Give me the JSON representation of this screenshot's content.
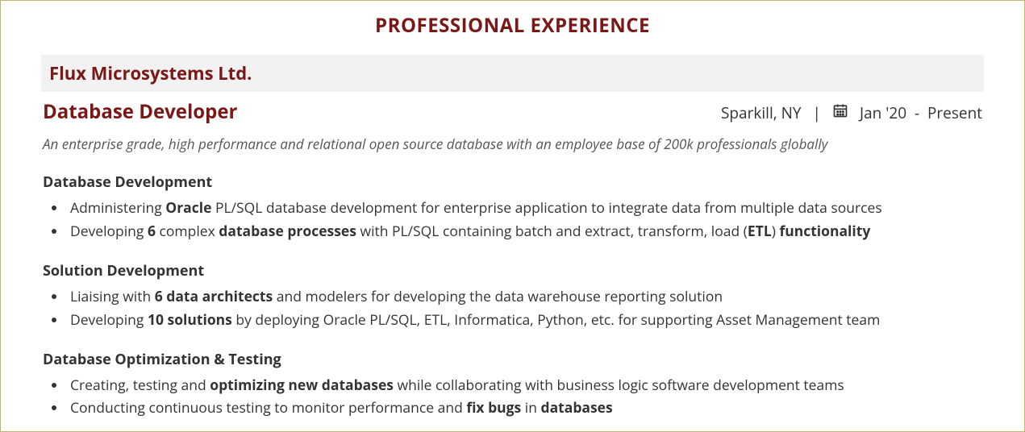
{
  "section_title": "PROFESSIONAL EXPERIENCE",
  "company": "Flux Microsystems Ltd.",
  "job_title": "Database Developer",
  "location": "Sparkill, NY",
  "date_start": "Jan '20",
  "date_end": "Present",
  "summary": "An enterprise grade, high performance and relational open source database with an employee base of 200k professionals globally",
  "groups": [
    {
      "heading": "Database Development",
      "bullets": [
        "Administering <b>Oracle</b> PL/SQL database development for enterprise application to integrate data from multiple data sources",
        "Developing <b>6</b> complex <b>database processes</b> with PL/SQL containing batch and extract, transform, load (<b>ETL</b>) <b>functionality</b>"
      ]
    },
    {
      "heading": "Solution Development",
      "bullets": [
        "Liaising with <b>6 data architects</b> and modelers for developing the data warehouse reporting solution",
        "Developing <b>10 solutions</b> by deploying Oracle PL/SQL, ETL, Informatica, Python, etc. for supporting Asset Management team"
      ]
    },
    {
      "heading": "Database Optimization & Testing",
      "bullets": [
        "Creating, testing and <b>optimizing new databases</b> while collaborating with business logic software development teams",
        "Conducting continuous testing to monitor performance and <b>fix bugs</b> in <b>databases</b>"
      ]
    }
  ]
}
